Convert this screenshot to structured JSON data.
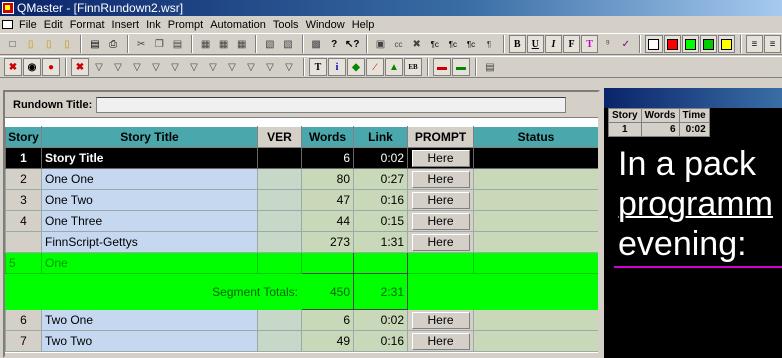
{
  "window": {
    "title": "QMaster - [FinnRundown2.wsr]"
  },
  "menu": [
    "File",
    "Edit",
    "Format",
    "Insert",
    "Ink",
    "Prompt",
    "Automation",
    "Tools",
    "Window",
    "Help"
  ],
  "rundown": {
    "title_label": "Rundown Title:",
    "title_value": "",
    "columns": [
      "Story",
      "Story Title",
      "VER",
      "Words",
      "Link",
      "PROMPT",
      "Status"
    ],
    "rows": [
      {
        "story": "1",
        "title": "Story Title",
        "ver": "",
        "words": "6",
        "link": "0:02",
        "prompt": "Here",
        "status": ""
      },
      {
        "story": "2",
        "title": "One One",
        "ver": "",
        "words": "80",
        "link": "0:27",
        "prompt": "Here",
        "status": ""
      },
      {
        "story": "3",
        "title": "One Two",
        "ver": "",
        "words": "47",
        "link": "0:16",
        "prompt": "Here",
        "status": ""
      },
      {
        "story": "4",
        "title": "One Three",
        "ver": "",
        "words": "44",
        "link": "0:15",
        "prompt": "Here",
        "status": ""
      },
      {
        "story": "",
        "title": "FinnScript-Gettys",
        "ver": "",
        "words": "273",
        "link": "1:31",
        "prompt": "Here",
        "status": ""
      }
    ],
    "segment": {
      "story": "5",
      "title": "One"
    },
    "segment_totals": {
      "label": "Segment Totals:",
      "words": "450",
      "link": "2:31"
    },
    "rows2": [
      {
        "story": "6",
        "title": "Two One",
        "ver": "",
        "words": "6",
        "link": "0:02",
        "prompt": "Here",
        "status": ""
      },
      {
        "story": "7",
        "title": "Two Two",
        "ver": "",
        "words": "49",
        "link": "0:16",
        "prompt": "Here",
        "status": ""
      }
    ]
  },
  "prompter": {
    "columns": [
      "Story",
      "Words",
      "Time"
    ],
    "story": "1",
    "words": "6",
    "time": "0:02",
    "lines": [
      "In a pack",
      "programm",
      "evening:"
    ]
  },
  "colors": {
    "header_teal": "#4aa8ac",
    "segment_green": "#00ff00",
    "selected_black": "#000000",
    "cue_magenta": "#d100d1"
  }
}
